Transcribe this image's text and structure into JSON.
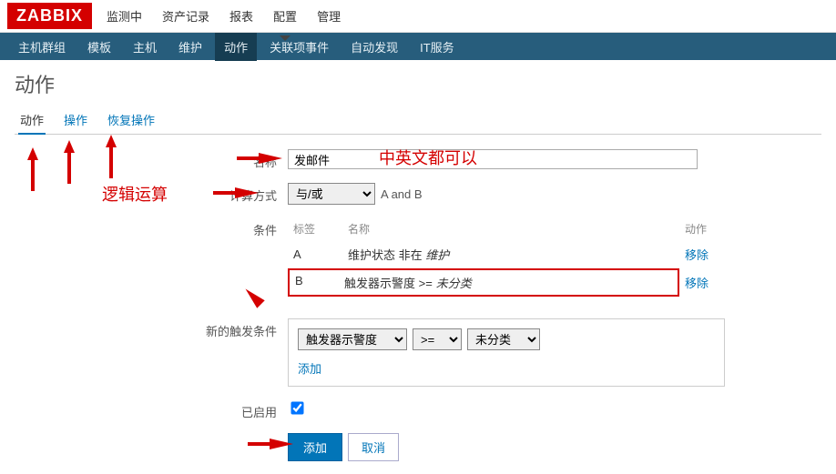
{
  "logo": "ZABBIX",
  "topnav": [
    "监测中",
    "资产记录",
    "报表",
    "配置",
    "管理"
  ],
  "topnav_active": 3,
  "subnav": [
    "主机群组",
    "模板",
    "主机",
    "维护",
    "动作",
    "关联项事件",
    "自动发现",
    "IT服务"
  ],
  "subnav_active": 4,
  "page_title": "动作",
  "tabs": [
    "动作",
    "操作",
    "恢复操作"
  ],
  "tabs_active": 0,
  "form": {
    "name_label": "名称",
    "name_value": "发邮件",
    "calc_label": "计算方式",
    "calc_selected": "与/或",
    "calc_expr": "A and B",
    "cond_label": "条件",
    "cond_headers": {
      "tag": "标签",
      "name": "名称",
      "action": "动作"
    },
    "conditions": [
      {
        "tag": "A",
        "name_prefix": "维护状态 非在",
        "name_italic": "维护",
        "action": "移除"
      },
      {
        "tag": "B",
        "name_prefix": "触发器示警度 >=",
        "name_italic": "未分类",
        "action": "移除"
      }
    ],
    "new_cond_label": "新的触发条件",
    "new_cond_type": "触发器示警度",
    "new_cond_op": ">=",
    "new_cond_value": "未分类",
    "add_link": "添加",
    "enabled_label": "已启用",
    "enabled_checked": true,
    "submit": "添加",
    "cancel": "取消"
  },
  "annotations": {
    "note1": "中英文都可以",
    "note2": "逻辑运算"
  }
}
